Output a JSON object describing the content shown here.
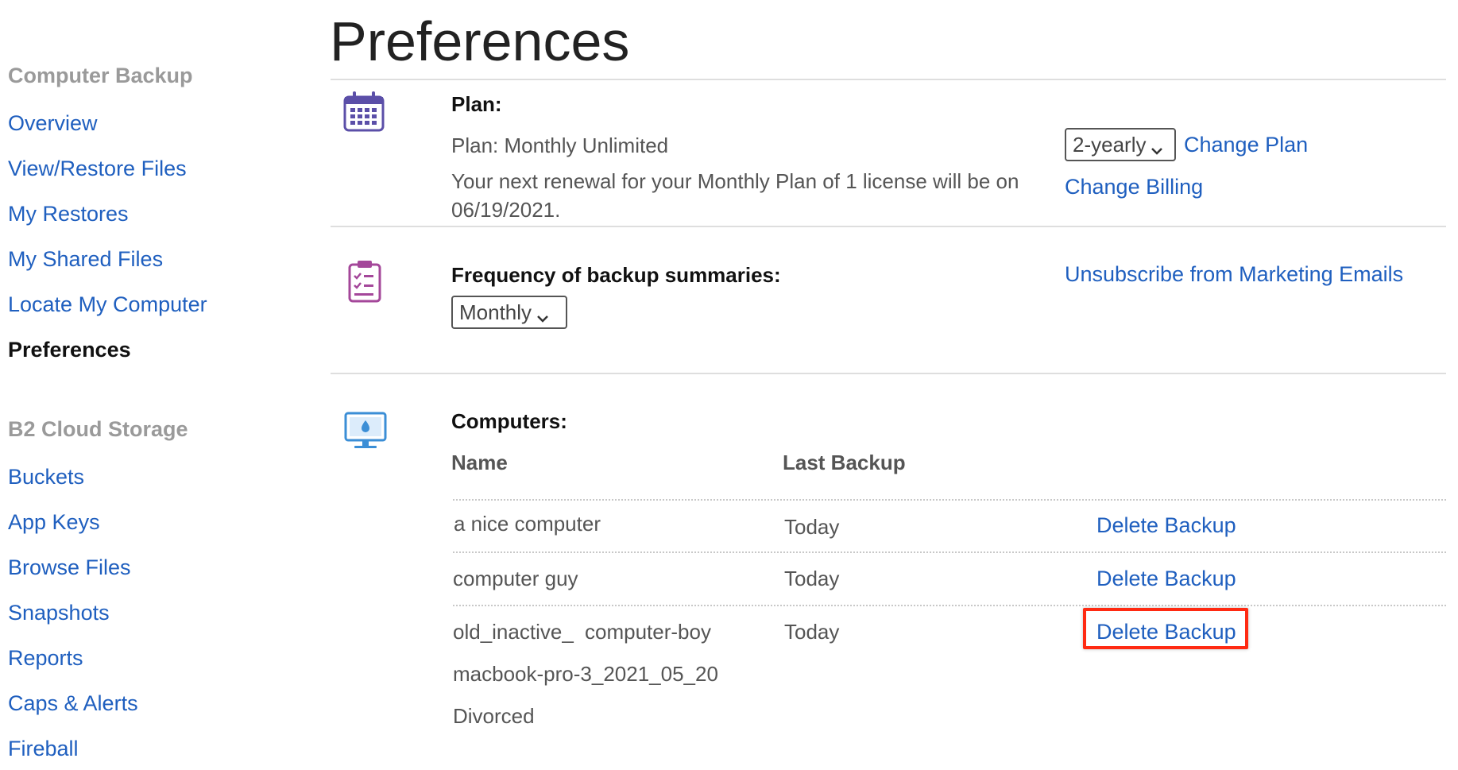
{
  "sidebar": {
    "computer_backup_heading": "Computer Backup",
    "computer_backup_items": [
      {
        "label": "Overview"
      },
      {
        "label": "View/Restore Files"
      },
      {
        "label": "My Restores"
      },
      {
        "label": "My Shared Files"
      },
      {
        "label": "Locate My Computer"
      },
      {
        "label": "Preferences"
      }
    ],
    "b2_heading": "B2 Cloud Storage",
    "b2_items": [
      {
        "label": "Buckets"
      },
      {
        "label": "App Keys"
      },
      {
        "label": "Browse Files"
      },
      {
        "label": "Snapshots"
      },
      {
        "label": "Reports"
      },
      {
        "label": "Caps & Alerts"
      },
      {
        "label": "Fireball"
      }
    ]
  },
  "main": {
    "title": "Preferences",
    "plan": {
      "heading": "Plan:",
      "plan_text": "Plan: Monthly Unlimited",
      "renewal_line1": "Your next renewal for your Monthly Plan of 1 license will be on",
      "renewal_line2": "06/19/2021.",
      "plan_select_value": "2-yearly",
      "change_plan_label": "Change Plan",
      "change_billing_label": "Change Billing"
    },
    "frequency": {
      "heading": "Frequency of backup summaries:",
      "select_value": "Monthly",
      "unsubscribe_label": "Unsubscribe from Marketing Emails"
    },
    "computers": {
      "heading": "Computers:",
      "columns": {
        "name": "Name",
        "last_backup": "Last Backup"
      },
      "rows": [
        {
          "name": "a nice computer",
          "last_backup": "Today",
          "action": "Delete Backup"
        },
        {
          "name": "computer guy",
          "last_backup": "Today",
          "action": "Delete Backup"
        },
        {
          "name_part1": "old_inactive_",
          "name_part2": "computer-boy",
          "last_backup": "Today",
          "action": "Delete Backup"
        }
      ],
      "extra_lines": [
        "macbook-pro-3_2021_05_20",
        "Divorced"
      ]
    }
  },
  "colors": {
    "link": "#1f5fbf",
    "highlight": "#ff2a12",
    "calendar_icon": "#5b4fa8",
    "clipboard_icon": "#a4479a",
    "monitor_icon": "#3b8ed6"
  },
  "icons": {
    "plan": "calendar-icon",
    "frequency": "clipboard-checklist-icon",
    "computers": "monitor-icon"
  }
}
